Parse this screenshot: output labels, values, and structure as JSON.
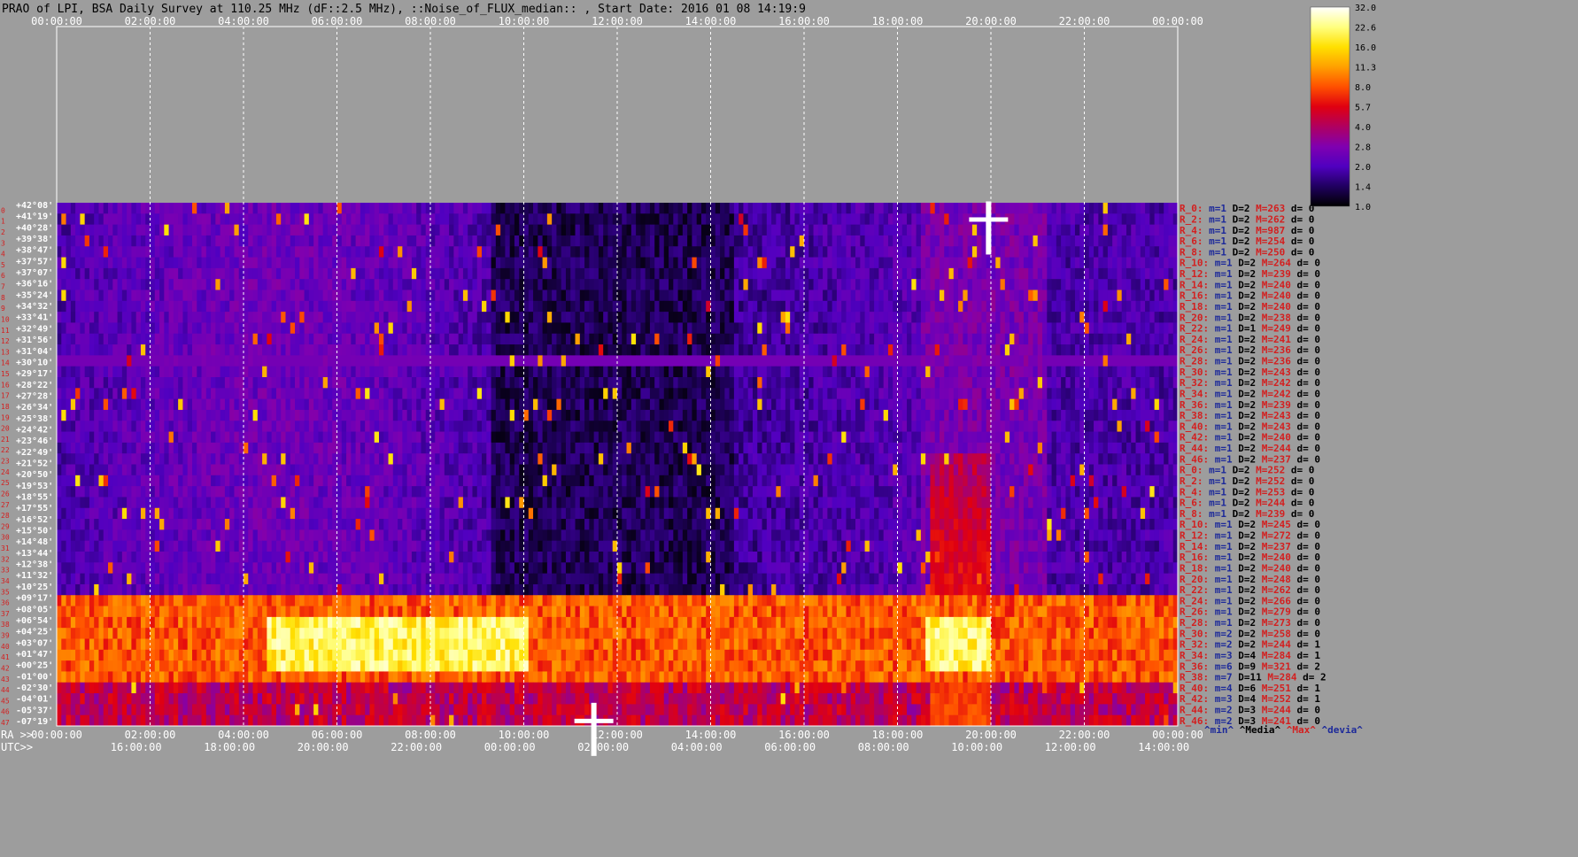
{
  "title": "PRAO of LPI, BSA Daily Survey at 110.25 MHz (dF::2.5 MHz), ::Noise_of_FLUX_median:: , Start Date: 2016 01 08 14:19:9",
  "colors": {
    "background": "#9d9d9d",
    "axis_text": "#ffffff",
    "ra_label_text": "#ffffff",
    "beam_index_text": "#d32020",
    "stat_R": "#d32020",
    "stat_m": "#1d2a9a",
    "stat_D": "#000000",
    "stat_M": "#d32020",
    "stat_d": "#000000",
    "legend_min": "#1d2a9a",
    "legend_media": "#000000",
    "legend_max": "#d32020",
    "legend_devia": "#1d2a9a"
  },
  "chart_data": {
    "type": "heatmap",
    "title": "PRAO of LPI, BSA Daily Survey at 110.25 MHz (dF::2.5 MHz), ::Noise_of_FLUX_median:: , Start Date: 2016 01 08 14:19:9",
    "x_axis_top": {
      "label": "",
      "ticks": [
        "00:00:00",
        "02:00:00",
        "04:00:00",
        "06:00:00",
        "08:00:00",
        "10:00:00",
        "12:00:00",
        "14:00:00",
        "16:00:00",
        "18:00:00",
        "20:00:00",
        "22:00:00",
        "00:00:00"
      ]
    },
    "x_axis_ra": {
      "label": "RA >>",
      "ticks": [
        "00:00:00",
        "02:00:00",
        "04:00:00",
        "06:00:00",
        "08:00:00",
        "10:00:00",
        "12:00:00",
        "14:00:00",
        "16:00:00",
        "18:00:00",
        "20:00:00",
        "22:00:00",
        "00:00:00"
      ]
    },
    "x_axis_utc": {
      "label": "UTC>>",
      "ticks": [
        "16:00:00",
        "18:00:00",
        "20:00:00",
        "22:00:00",
        "00:00:00",
        "02:00:00",
        "04:00:00",
        "06:00:00",
        "08:00:00",
        "10:00:00",
        "12:00:00",
        "14:00:00"
      ]
    },
    "y_declination_labels": [
      "+42°08'",
      "+41°19'",
      "+40°28'",
      "+39°38'",
      "+38°47'",
      "+37°57'",
      "+37°07'",
      "+36°16'",
      "+35°24'",
      "+34°32'",
      "+33°41'",
      "+32°49'",
      "+31°56'",
      "+31°04'",
      "+30°10'",
      "+29°17'",
      "+28°22'",
      "+27°28'",
      "+26°34'",
      "+25°38'",
      "+24°42'",
      "+23°46'",
      "+22°49'",
      "+21°52'",
      "+20°50'",
      "+19°53'",
      "+18°55'",
      "+17°55'",
      "+16°52'",
      "+15°50'",
      "+14°48'",
      "+13°44'",
      "+12°38'",
      "+11°32'",
      "+10°25'",
      "+09°17'",
      "+08°05'",
      "+06°54'",
      "+04°25'",
      "+03°07'",
      "+01°47'",
      "+00°25'",
      "-01°00'",
      "-02°30'",
      "-04°01'",
      "-05°37'",
      "-07°19'"
    ],
    "beam_stats": [
      {
        "R": "R_0:",
        "m": "m=1",
        "D": "D=2",
        "M": "M=263",
        "d": "d= 0"
      },
      {
        "R": "R_2:",
        "m": "m=1",
        "D": "D=2",
        "M": "M=262",
        "d": "d= 0"
      },
      {
        "R": "R_4:",
        "m": "m=1",
        "D": "D=2",
        "M": "M=987",
        "d": "d= 0"
      },
      {
        "R": "R_6:",
        "m": "m=1",
        "D": "D=2",
        "M": "M=254",
        "d": "d= 0"
      },
      {
        "R": "R_8:",
        "m": "m=1",
        "D": "D=2",
        "M": "M=250",
        "d": "d= 0"
      },
      {
        "R": "R_10:",
        "m": "m=1",
        "D": "D=2",
        "M": "M=264",
        "d": "d= 0"
      },
      {
        "R": "R_12:",
        "m": "m=1",
        "D": "D=2",
        "M": "M=239",
        "d": "d= 0"
      },
      {
        "R": "R_14:",
        "m": "m=1",
        "D": "D=2",
        "M": "M=240",
        "d": "d= 0"
      },
      {
        "R": "R_16:",
        "m": "m=1",
        "D": "D=2",
        "M": "M=240",
        "d": "d= 0"
      },
      {
        "R": "R_18:",
        "m": "m=1",
        "D": "D=2",
        "M": "M=240",
        "d": "d= 0"
      },
      {
        "R": "R_20:",
        "m": "m=1",
        "D": "D=2",
        "M": "M=238",
        "d": "d= 0"
      },
      {
        "R": "R_22:",
        "m": "m=1",
        "D": "D=1",
        "M": "M=249",
        "d": "d= 0"
      },
      {
        "R": "R_24:",
        "m": "m=1",
        "D": "D=2",
        "M": "M=241",
        "d": "d= 0"
      },
      {
        "R": "R_26:",
        "m": "m=1",
        "D": "D=2",
        "M": "M=236",
        "d": "d= 0"
      },
      {
        "R": "R_28:",
        "m": "m=1",
        "D": "D=2",
        "M": "M=236",
        "d": "d= 0"
      },
      {
        "R": "R_30:",
        "m": "m=1",
        "D": "D=2",
        "M": "M=243",
        "d": "d= 0"
      },
      {
        "R": "R_32:",
        "m": "m=1",
        "D": "D=2",
        "M": "M=242",
        "d": "d= 0"
      },
      {
        "R": "R_34:",
        "m": "m=1",
        "D": "D=2",
        "M": "M=242",
        "d": "d= 0"
      },
      {
        "R": "R_36:",
        "m": "m=1",
        "D": "D=2",
        "M": "M=239",
        "d": "d= 0"
      },
      {
        "R": "R_38:",
        "m": "m=1",
        "D": "D=2",
        "M": "M=243",
        "d": "d= 0"
      },
      {
        "R": "R_40:",
        "m": "m=1",
        "D": "D=2",
        "M": "M=243",
        "d": "d= 0"
      },
      {
        "R": "R_42:",
        "m": "m=1",
        "D": "D=2",
        "M": "M=240",
        "d": "d= 0"
      },
      {
        "R": "R_44:",
        "m": "m=1",
        "D": "D=2",
        "M": "M=244",
        "d": "d= 0"
      },
      {
        "R": "R_46:",
        "m": "m=1",
        "D": "D=2",
        "M": "M=237",
        "d": "d= 0"
      },
      {
        "R": "R_0:",
        "m": "m=1",
        "D": "D=2",
        "M": "M=252",
        "d": "d= 0"
      },
      {
        "R": "R_2:",
        "m": "m=1",
        "D": "D=2",
        "M": "M=252",
        "d": "d= 0"
      },
      {
        "R": "R_4:",
        "m": "m=1",
        "D": "D=2",
        "M": "M=253",
        "d": "d= 0"
      },
      {
        "R": "R_6:",
        "m": "m=1",
        "D": "D=2",
        "M": "M=244",
        "d": "d= 0"
      },
      {
        "R": "R_8:",
        "m": "m=1",
        "D": "D=2",
        "M": "M=239",
        "d": "d= 0"
      },
      {
        "R": "R_10:",
        "m": "m=1",
        "D": "D=2",
        "M": "M=245",
        "d": "d= 0"
      },
      {
        "R": "R_12:",
        "m": "m=1",
        "D": "D=2",
        "M": "M=272",
        "d": "d= 0"
      },
      {
        "R": "R_14:",
        "m": "m=1",
        "D": "D=2",
        "M": "M=237",
        "d": "d= 0"
      },
      {
        "R": "R_16:",
        "m": "m=1",
        "D": "D=2",
        "M": "M=240",
        "d": "d= 0"
      },
      {
        "R": "R_18:",
        "m": "m=1",
        "D": "D=2",
        "M": "M=240",
        "d": "d= 0"
      },
      {
        "R": "R_20:",
        "m": "m=1",
        "D": "D=2",
        "M": "M=248",
        "d": "d= 0"
      },
      {
        "R": "R_22:",
        "m": "m=1",
        "D": "D=2",
        "M": "M=262",
        "d": "d= 0"
      },
      {
        "R": "R_24:",
        "m": "m=1",
        "D": "D=2",
        "M": "M=266",
        "d": "d= 0"
      },
      {
        "R": "R_26:",
        "m": "m=1",
        "D": "D=2",
        "M": "M=279",
        "d": "d= 0"
      },
      {
        "R": "R_28:",
        "m": "m=1",
        "D": "D=2",
        "M": "M=273",
        "d": "d= 0"
      },
      {
        "R": "R_30:",
        "m": "m=2",
        "D": "D=2",
        "M": "M=258",
        "d": "d= 0"
      },
      {
        "R": "R_32:",
        "m": "m=2",
        "D": "D=2",
        "M": "M=244",
        "d": "d= 1"
      },
      {
        "R": "R_34:",
        "m": "m=3",
        "D": "D=4",
        "M": "M=284",
        "d": "d= 1"
      },
      {
        "R": "R_36:",
        "m": "m=6",
        "D": "D=9",
        "M": "M=321",
        "d": "d= 2"
      },
      {
        "R": "R_38:",
        "m": "m=7",
        "D": "D=11",
        "M": "M=284",
        "d": "d= 2"
      },
      {
        "R": "R_40:",
        "m": "m=4",
        "D": "D=6",
        "M": "M=251",
        "d": "d= 1"
      },
      {
        "R": "R_42:",
        "m": "m=3",
        "D": "D=4",
        "M": "M=252",
        "d": "d= 1"
      },
      {
        "R": "R_44:",
        "m": "m=2",
        "D": "D=3",
        "M": "M=244",
        "d": "d= 0"
      },
      {
        "R": "R_46:",
        "m": "m=2",
        "D": "D=3",
        "M": "M=241",
        "d": "d= 0"
      }
    ],
    "stats_legend": [
      "^min^",
      "^Media^",
      "^Max^",
      "^devia^"
    ],
    "colorbar": {
      "labels": [
        "32.0",
        "22.6",
        "16.0",
        "11.3",
        "8.0",
        "5.7",
        "4.0",
        "2.8",
        "2.0",
        "1.4",
        "1.0"
      ],
      "min": 1.0,
      "max": 32.0,
      "scale": "log",
      "palette": [
        "#ffffff",
        "#ffff80",
        "#ffe000",
        "#ffa000",
        "#ff5000",
        "#e00010",
        "#b00060",
        "#8000b0",
        "#5000c0",
        "#200060",
        "#000000"
      ]
    },
    "features": [
      {
        "name": "equatorial band",
        "ra_start_h": 0.0,
        "ra_end_h": 24.0,
        "dec_rows": [
          36,
          43
        ],
        "level": 11.3
      },
      {
        "name": "bright band segment",
        "ra_start_h": 4.5,
        "ra_end_h": 10.15,
        "dec_rows": [
          38,
          42
        ],
        "level": 22.6
      },
      {
        "name": "bright band segment",
        "ra_start_h": 18.6,
        "ra_end_h": 20.0,
        "dec_rows": [
          38,
          42
        ],
        "level": 32.0
      },
      {
        "name": "bright source",
        "ra_h": 19.95,
        "dec_row": 1,
        "level": 32.0
      },
      {
        "name": "bright source",
        "ra_h": 11.5,
        "dec_row": 47,
        "level": 32.0
      },
      {
        "name": "horizontal interference",
        "dec_row": 14,
        "level": 2.8
      }
    ],
    "grid": true
  }
}
